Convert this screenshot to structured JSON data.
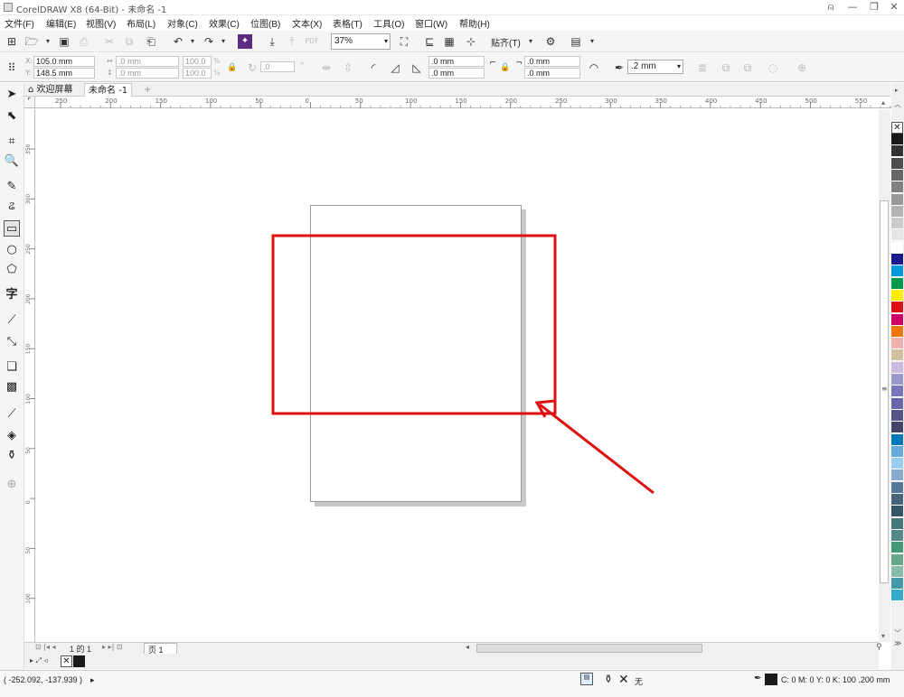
{
  "window": {
    "title": "CorelDRAW X8 (64-Bit) - 未命名 -1"
  },
  "menu": [
    "文件(F)",
    "编辑(E)",
    "视图(V)",
    "布局(L)",
    "对象(C)",
    "效果(C)",
    "位图(B)",
    "文本(X)",
    "表格(T)",
    "工具(O)",
    "窗口(W)",
    "帮助(H)"
  ],
  "toolbar": {
    "zoom": "37%",
    "snap_label": "贴齐(T)"
  },
  "property_bar": {
    "x": "105.0 mm",
    "y": "148.5 mm",
    "width": ".0 mm",
    "height": ".0 mm",
    "scale_x": "100.0",
    "scale_y": "100.0",
    "percent": "%",
    "rotation": ".0",
    "corner_h": ".0 mm",
    "corner_v": ".0 mm",
    "corner_h2": ".0 mm",
    "corner_v2": ".0 mm",
    "outline_width": ".2 mm"
  },
  "tabs": {
    "welcome": "欢迎屏幕",
    "document": "未命名 -1"
  },
  "rulers": {
    "h_ticks": [
      "250",
      "200",
      "150",
      "100",
      "50",
      "0",
      "50",
      "100",
      "150",
      "200",
      "250",
      "300",
      "350",
      "400",
      "450",
      "500",
      "550"
    ],
    "v_ticks": [
      "350",
      "300",
      "250",
      "200",
      "150",
      "100",
      "50",
      "0",
      "50",
      "100"
    ]
  },
  "page_nav": {
    "page_of": "1 的 1",
    "page_tab": "页 1"
  },
  "status": {
    "coords": "( -252.092, -137.939 )",
    "fill_none": "无",
    "outline_info": "C: 0 M: 0 Y: 0 K: 100  .200 mm"
  },
  "palette_colors": [
    "#1a1a1a",
    "#333333",
    "#4d4d4d",
    "#666666",
    "#808080",
    "#999999",
    "#b3b3b3",
    "#cccccc",
    "#e6e6e6",
    "#ffffff",
    "#1a1a8c",
    "#0099dd",
    "#00994d",
    "#ffee00",
    "#dd1111",
    "#cc0066",
    "#ee7700",
    "#f0b0b0",
    "#d0c0a0",
    "#ccbbdd",
    "#9999cc",
    "#7777bb",
    "#6666aa",
    "#555588",
    "#444466",
    "#0077bb",
    "#66aadd",
    "#99ccee",
    "#88aacc",
    "#557799",
    "#446677",
    "#335566",
    "#447777",
    "#558888",
    "#449977",
    "#66aa88",
    "#88bbaa",
    "#4499aa",
    "#33aacc"
  ],
  "annotation": {
    "color": "#dd1111"
  }
}
